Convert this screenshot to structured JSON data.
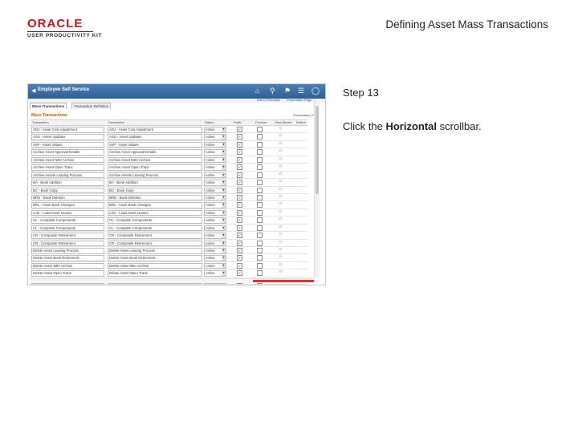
{
  "logo": {
    "word": "ORACLE",
    "sub": "USER PRODUCTIVITY KIT"
  },
  "doc_title": "Defining Asset Mass Transactions",
  "step": "Step 13",
  "instruction": {
    "before": "Click the ",
    "bold": "Horizontal",
    "after": " scrollbar."
  },
  "screenshot": {
    "title": "Employee Self Service",
    "subbar_links": [
      "Add to Favorites",
      "Personalize Page"
    ],
    "tabs": [
      "Mass Transactions",
      "Transaction Definition"
    ],
    "grid_title": "Mass Transactions",
    "grid_tools": "Personalize | Find",
    "columns": [
      "Transaction",
      "Description",
      "Status",
      "Prefix",
      "Concise",
      "View Modes",
      "Defaul"
    ],
    "rows": [
      {
        "txn": "ADJ - Asset Cost Adjustment",
        "desc": "ADJ - Asset Cost Adjustment",
        "status": "Active",
        "prefix": true
      },
      {
        "txn": "ASU - Asset Updates",
        "desc": "ASU - Asset Updates",
        "status": "Active",
        "prefix": true
      },
      {
        "txn": "AVP - Asset Values",
        "desc": "AVP - Asset Values",
        "status": "Active",
        "prefix": true
      },
      {
        "txn": "Archive Asset Approval Details",
        "desc": "Archive Asset Approval Details",
        "status": "Active",
        "prefix": true
      },
      {
        "txn": "Archive Asset NBV Archive",
        "desc": "Archive Asset NBV Archive",
        "status": "Active",
        "prefix": true
      },
      {
        "txn": "Archive Asset Open Trans",
        "desc": "Archive Asset Open Trans",
        "status": "Active",
        "prefix": true
      },
      {
        "txn": "Archive Assets Leasing Process",
        "desc": "Archive Assets Leasing Process",
        "status": "Active",
        "prefix": true
      },
      {
        "txn": "BA - Book Addition",
        "desc": "BA - Book Addition",
        "status": "Active",
        "prefix": true
      },
      {
        "txn": "BC - Book Copy",
        "desc": "BC - Book Copy",
        "status": "Active",
        "prefix": true
      },
      {
        "txn": "BRD - Book Deletion",
        "desc": "BRD - Book Deletion",
        "status": "Active",
        "prefix": true
      },
      {
        "txn": "BRL - Asset Book Changes",
        "desc": "BRL - Asset Book Changes",
        "status": "Active",
        "prefix": true
      },
      {
        "txn": "LAD - Load Asset Leases",
        "desc": "LAD - Load Asset Leases",
        "status": "Active",
        "prefix": true
      },
      {
        "txn": "CL - Complete Components",
        "desc": "CL - Complete Components",
        "status": "Active",
        "prefix": true
      },
      {
        "txn": "CL - Complete Components",
        "desc": "CL - Complete Components",
        "status": "Active",
        "prefix": true
      },
      {
        "txn": "CR - Composite Retirement",
        "desc": "CR - Composite Retirement",
        "status": "Active",
        "prefix": true
      },
      {
        "txn": "CR - Composite Retirement",
        "desc": "CR - Composite Retirement",
        "status": "Active",
        "prefix": true
      },
      {
        "txn": "Delete Asset Leasing Process",
        "desc": "Delete Asset Leasing Process",
        "status": "Active",
        "prefix": true
      },
      {
        "txn": "Delete Asset Book Retirement",
        "desc": "Delete Asset Book Retirement",
        "status": "Active",
        "prefix": true
      },
      {
        "txn": "Delete Asset NBV Archive",
        "desc": "Delete Asset NBV Archive",
        "status": "Active",
        "prefix": true
      },
      {
        "txn": "Delete Asset Open Trans",
        "desc": "Delete Asset Open Trans",
        "status": "Active",
        "prefix": true
      },
      {
        "txn": "EUROH-Restate RSP-New Book",
        "desc": "EUROH-Restate RSP-New Book",
        "status": "Active",
        "prefix": true
      }
    ]
  },
  "colors": {
    "accent_red": "#c8141b",
    "banner_blue": "#3b6ea5",
    "highlight": "#e03030"
  }
}
